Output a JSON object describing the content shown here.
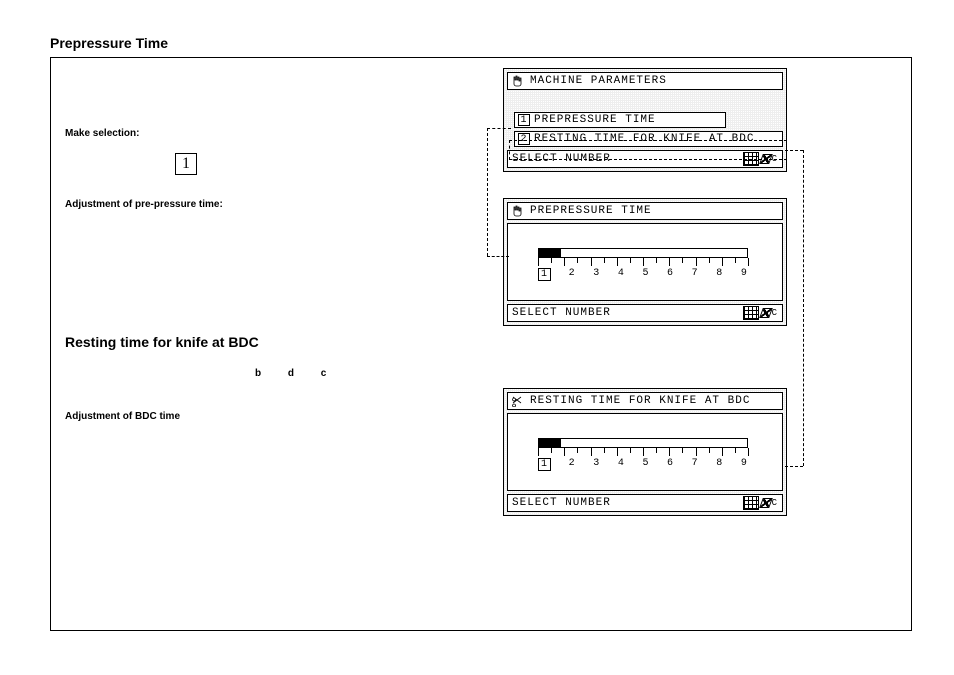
{
  "titles": {
    "section1": "Prepressure Time",
    "section2": "Resting time for knife at BDC"
  },
  "left": {
    "make_selection": "Make selection:",
    "selection_value": "1",
    "adjust_prepressure": "Adjustment of pre-pressure time:",
    "bdc_letters": "b d c",
    "adjust_bdc": "Adjustment of BDC time"
  },
  "panel_top": {
    "title": "MACHINE PARAMETERS",
    "items": [
      {
        "num": "1",
        "label": "PREPRESSURE TIME"
      },
      {
        "num": "2",
        "label": "RESTING TIME FOR KNIFE AT BDC"
      }
    ],
    "footer": "SELECT NUMBER",
    "clear": "C"
  },
  "panel_mid": {
    "title": "PREPRESSURE TIME",
    "footer": "SELECT NUMBER",
    "clear": "C",
    "scale": [
      "1",
      "2",
      "3",
      "4",
      "5",
      "6",
      "7",
      "8",
      "9"
    ],
    "selected_index": 0
  },
  "panel_bot": {
    "title": "RESTING TIME FOR KNIFE AT BDC",
    "footer": "SELECT NUMBER",
    "clear": "C",
    "scale": [
      "1",
      "2",
      "3",
      "4",
      "5",
      "6",
      "7",
      "8",
      "9"
    ],
    "selected_index": 0
  }
}
